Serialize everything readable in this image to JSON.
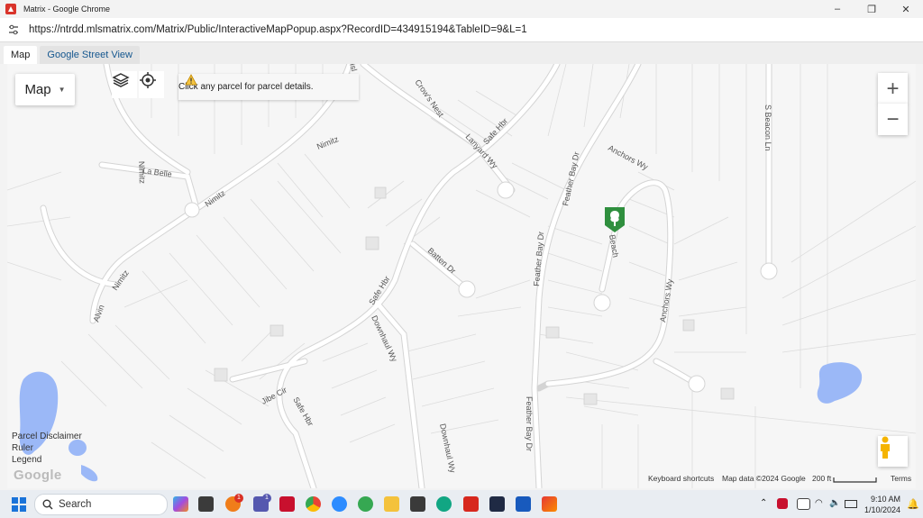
{
  "window": {
    "title": "Matrix - Google Chrome",
    "controls": [
      "–",
      "❐",
      "✕"
    ]
  },
  "browser": {
    "url": "https://ntrdd.mlsmatrix.com/Matrix/Public/InteractiveMapPopup.aspx?RecordID=434915194&TableID=9&L=1"
  },
  "tabs": [
    {
      "label": "Map",
      "active": true
    },
    {
      "label": "Google Street View",
      "active": false
    }
  ],
  "map": {
    "type_selector": "Map",
    "notice": "Click any parcel for parcel details.",
    "zoom_in": "+",
    "zoom_out": "−",
    "streets": [
      "Nimitz",
      "Nimitz",
      "Nimitz",
      "Nimitz",
      "La Belle",
      "Alvin",
      "Crow's Nest",
      "Lanyard Wy",
      "Safe Hbr",
      "Safe Hbr",
      "Safe Hbr",
      "Batten Dr",
      "Feather Bay Dr",
      "Feather Bay Dr",
      "Feather Bay Dr",
      "Anchors Wy",
      "Anchors Wy",
      "Beach",
      "S Beacon Ln",
      "Downhaul Wy",
      "Downhaul Wy",
      "Jibe Cir",
      "Isl"
    ],
    "links": [
      "Parcel Disclaimer",
      "Ruler",
      "Legend"
    ],
    "google_logo": "Google",
    "attribution": {
      "shortcuts": "Keyboard shortcuts",
      "map_data": "Map data ©2024 Google",
      "scale": "200 ft",
      "terms": "Terms"
    },
    "colors": {
      "water": "#9bb8f7",
      "road": "#ffffff",
      "parcel_line": "#d9d9d9",
      "marker": "#2f8f3e"
    }
  },
  "taskbar": {
    "search_label": "Search",
    "time": "9:10 AM",
    "date": "1/10/2024",
    "icons": [
      "start-icon",
      "search-icon",
      "copilot-icon",
      "store-icon",
      "files-icon",
      "firefox-icon",
      "teams-icon",
      "mcafee-icon",
      "chrome-icon",
      "zoom-icon",
      "app-icon",
      "file-explorer-icon",
      "camera-icon",
      "grammarly-icon",
      "acrobat-icon",
      "ccleaner-icon",
      "word-icon",
      "matrix-icon"
    ],
    "badges": {
      "firefox": "1",
      "teams": "1"
    }
  }
}
